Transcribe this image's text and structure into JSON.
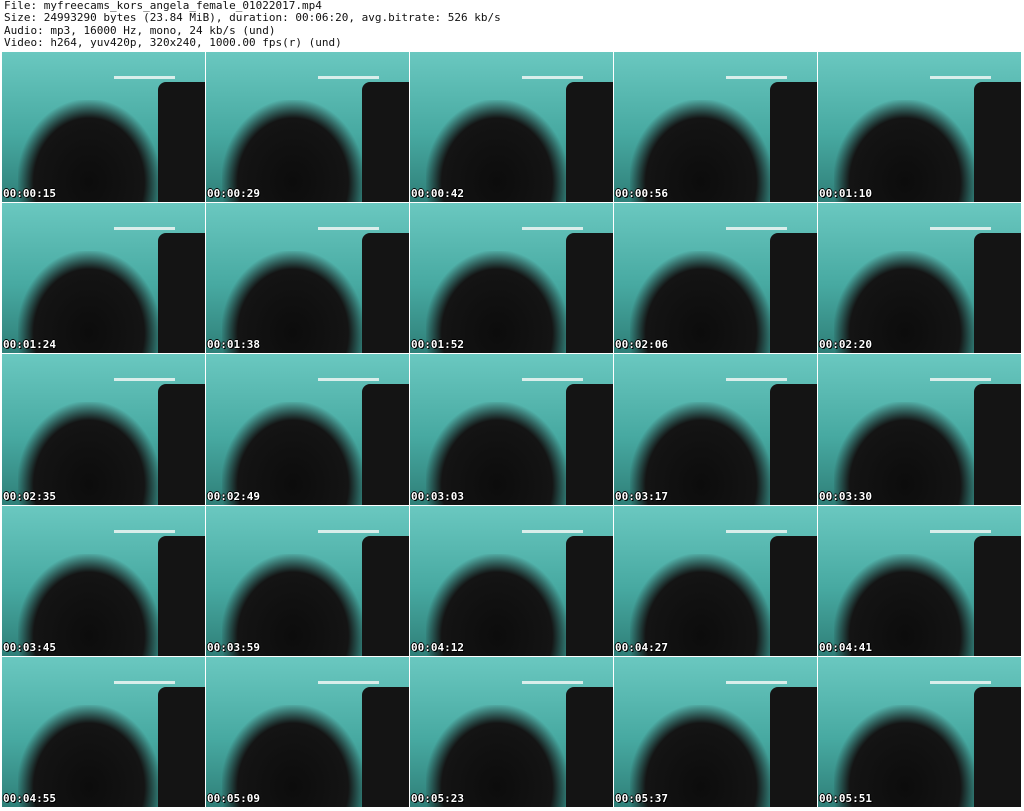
{
  "header": {
    "file_line": "File: myfreecams_kors_angela_female_01022017.mp4",
    "size_line": "Size: 24993290 bytes (23.84 MiB), duration: 00:06:20, avg.bitrate: 526 kb/s",
    "audio_line": "Audio: mp3, 16000 Hz, mono, 24 kb/s (und)",
    "video_line": "Video: h264, yuv420p, 320x240, 1000.00 fps(r) (und)"
  },
  "colors": {
    "background": "#ffffff",
    "timestamp": "#ffffff",
    "frame_wall": "#4fb4ad"
  },
  "thumbnails": [
    {
      "timestamp": "00:00:15"
    },
    {
      "timestamp": "00:00:29"
    },
    {
      "timestamp": "00:00:42"
    },
    {
      "timestamp": "00:00:56"
    },
    {
      "timestamp": "00:01:10"
    },
    {
      "timestamp": "00:01:24"
    },
    {
      "timestamp": "00:01:38"
    },
    {
      "timestamp": "00:01:52"
    },
    {
      "timestamp": "00:02:06"
    },
    {
      "timestamp": "00:02:20"
    },
    {
      "timestamp": "00:02:35"
    },
    {
      "timestamp": "00:02:49"
    },
    {
      "timestamp": "00:03:03"
    },
    {
      "timestamp": "00:03:17"
    },
    {
      "timestamp": "00:03:30"
    },
    {
      "timestamp": "00:03:45"
    },
    {
      "timestamp": "00:03:59"
    },
    {
      "timestamp": "00:04:12"
    },
    {
      "timestamp": "00:04:27"
    },
    {
      "timestamp": "00:04:41"
    },
    {
      "timestamp": "00:04:55"
    },
    {
      "timestamp": "00:05:09"
    },
    {
      "timestamp": "00:05:23"
    },
    {
      "timestamp": "00:05:37"
    },
    {
      "timestamp": "00:05:51"
    }
  ]
}
